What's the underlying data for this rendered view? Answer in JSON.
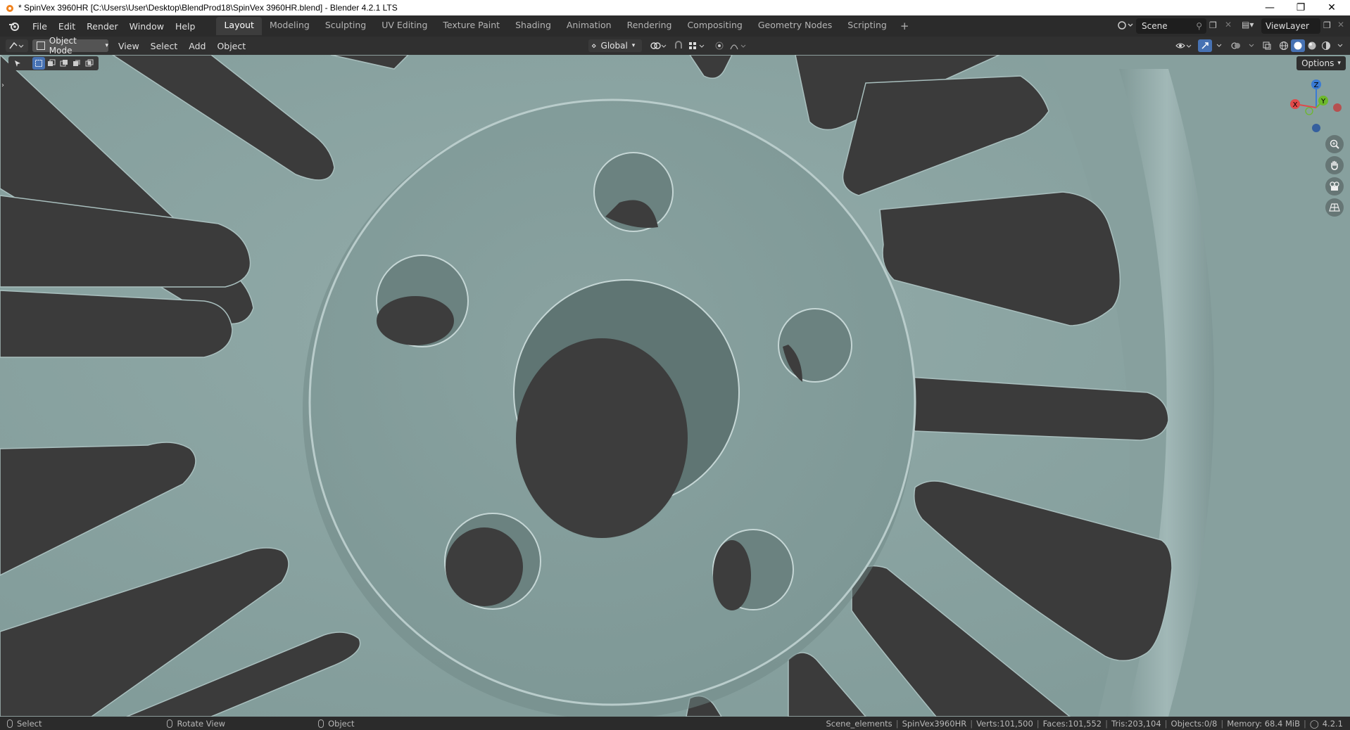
{
  "window": {
    "title": "* SpinVex 3960HR [C:\\Users\\User\\Desktop\\BlendProd18\\SpinVex 3960HR.blend] - Blender 4.2.1 LTS"
  },
  "menus": [
    "File",
    "Edit",
    "Render",
    "Window",
    "Help"
  ],
  "workspaces": [
    {
      "label": "Layout",
      "active": true
    },
    {
      "label": "Modeling"
    },
    {
      "label": "Sculpting"
    },
    {
      "label": "UV Editing"
    },
    {
      "label": "Texture Paint"
    },
    {
      "label": "Shading"
    },
    {
      "label": "Animation"
    },
    {
      "label": "Rendering"
    },
    {
      "label": "Compositing"
    },
    {
      "label": "Geometry Nodes"
    },
    {
      "label": "Scripting"
    }
  ],
  "add_workspace": "+",
  "scene": {
    "name": "Scene"
  },
  "view_layer": {
    "name": "ViewLayer"
  },
  "viewport_header": {
    "mode": "Object Mode",
    "menus": [
      "View",
      "Select",
      "Add",
      "Object"
    ],
    "transform_orientation": "Global"
  },
  "viewport": {
    "options_label": "Options",
    "gizmo_axes": {
      "x": "X",
      "y": "Y",
      "z": "Z"
    }
  },
  "status_bar": {
    "hints": [
      {
        "label": "Select"
      },
      {
        "label": "Rotate View"
      },
      {
        "label": "Object"
      }
    ],
    "stats": {
      "collection": "Scene_elements",
      "object": "SpinVex3960HR",
      "verts": "Verts:101,500",
      "faces": "Faces:101,552",
      "tris": "Tris:203,104",
      "objects": "Objects:0/8",
      "memory": "Memory: 68.4 MiB",
      "version": "4.2.1"
    }
  },
  "colors": {
    "surface": "#8fa9a7",
    "hole": "#3d3d3d",
    "topbar": "#2b2b2b",
    "gizmo_x": "#e04a4a",
    "gizmo_y": "#6db82c",
    "gizmo_z": "#3a7bd5"
  }
}
